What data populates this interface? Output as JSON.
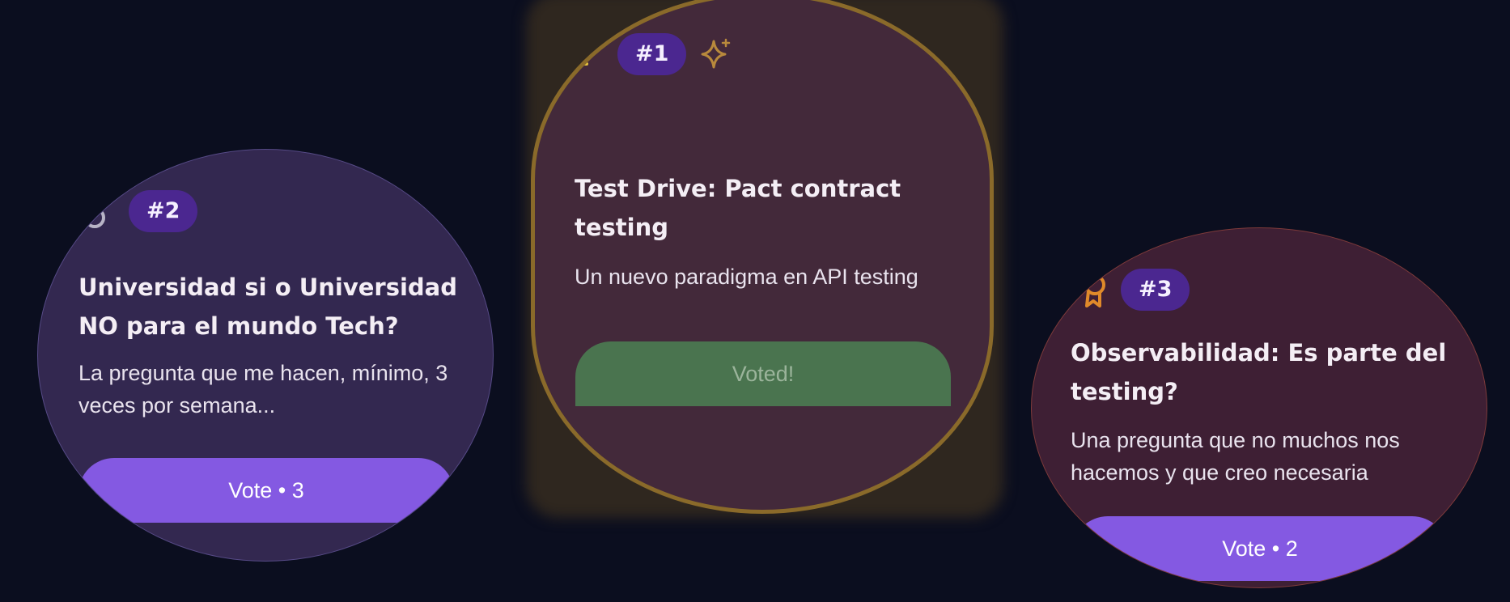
{
  "cards": [
    {
      "rank": "#2",
      "icon": "medal-silver-icon",
      "title": "Universidad si o Universidad NO para el mundo Tech?",
      "description": "La pregunta que me hacen, mínimo, 3 veces por semana...",
      "button_label": "Vote • 3",
      "accent": "#8459e2"
    },
    {
      "rank": "#1",
      "icon": "trophy-gold-icon",
      "badge_icon": "sparkle-icon",
      "title": "Test Drive: Pact contract testing",
      "description": "Un nuevo paradigma en API testing",
      "button_label": "Voted!",
      "accent": "#4a744f"
    },
    {
      "rank": "#3",
      "icon": "award-bronze-icon",
      "title": "Observabilidad: Es parte del testing?",
      "description": "Una pregunta que no muchos nos hacemos y que creo necesaria",
      "button_label": "Vote • 2",
      "accent": "#8459e2"
    }
  ],
  "colors": {
    "background": "#0b0e1f",
    "badge": "#4b2790",
    "gold_border": "#8a6a2a"
  }
}
